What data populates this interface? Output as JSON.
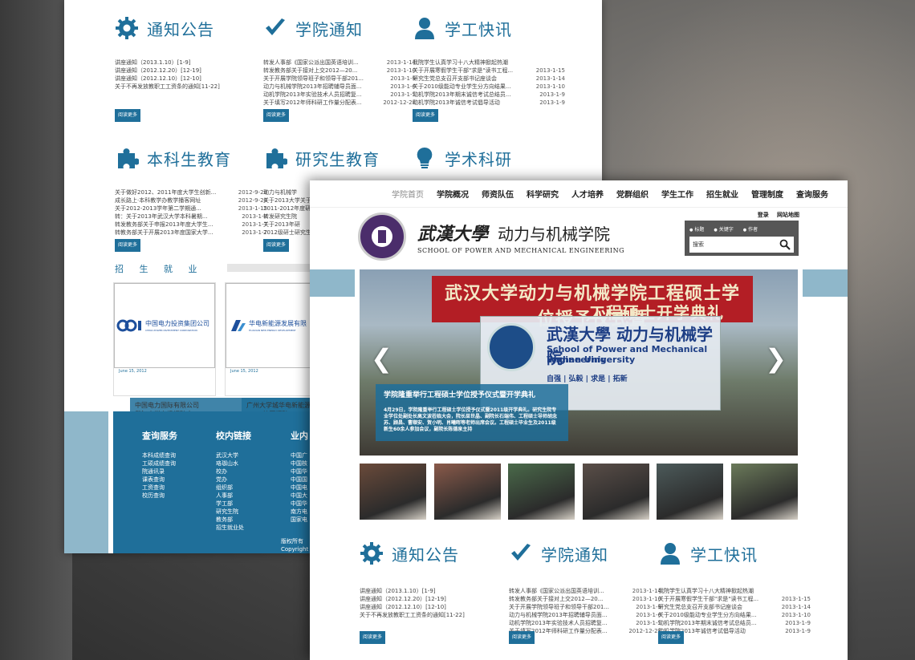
{
  "back": {
    "sections": [
      {
        "key": "notice",
        "title": "通知公告",
        "icon": "gear-icon",
        "items": [
          {
            "t": "讲座通知（2013.1.10）[1-9]",
            "d": ""
          },
          {
            "t": "讲座通知（2012.12.20）[12-19]",
            "d": ""
          },
          {
            "t": "讲座通知（2012.12.10）[12-10]",
            "d": ""
          },
          {
            "t": "关于不再发放教职工工资条的通知[11-22]",
            "d": ""
          }
        ]
      },
      {
        "key": "college",
        "title": "学院通知",
        "icon": "checkmark-icon",
        "items": [
          {
            "t": "转发人事部《国家公派出国英语培训...",
            "d": "2013-1-14"
          },
          {
            "t": "转发教务部关于接对上交2012—20...",
            "d": "2013-1-10"
          },
          {
            "t": "关于开展学院领导班子和领导干部201...",
            "d": "2013-1-9"
          },
          {
            "t": "动力与机械学院2013年招聘辅导员面...",
            "d": "2013-1-6"
          },
          {
            "t": "动机学院2013年实验技术人员招聘复...",
            "d": "2013-1-5"
          },
          {
            "t": "关于填写2012年师科研工作量分配表...",
            "d": "2012-12-28"
          }
        ]
      },
      {
        "key": "student",
        "title": "学工快讯",
        "icon": "user-icon",
        "items": [
          {
            "t": "我院学生认真学习十八大精神掀起热潮",
            "d": ""
          },
          {
            "t": "关于开展寒假学生干部\"求是\"读书工程...",
            "d": "2013-1-15"
          },
          {
            "t": "研究生党总支召开支部书记座谈会",
            "d": "2013-1-14"
          },
          {
            "t": "关于2010级能动专业学生分方向结果...",
            "d": "2013-1-10"
          },
          {
            "t": "动机学院2013年期末诚信考试总结员...",
            "d": "2013-1-9"
          },
          {
            "t": "动机学院2013年诚信考试倡导活动",
            "d": "2013-1-9"
          }
        ]
      },
      {
        "key": "undergrad",
        "title": "本科生教育",
        "icon": "puzzle-icon",
        "items": [
          {
            "t": "关于做好2012、2011年度大学生创新...",
            "d": "2012-9-28"
          },
          {
            "t": "成长路上·本科教学办教学播客网址",
            "d": "2012-9-28"
          },
          {
            "t": "关于2012-2013学年第二学期通...",
            "d": "2013-1-15"
          },
          {
            "t": "转：关于2013年武汉大学本科暑期...",
            "d": "2013-1-8"
          },
          {
            "t": "转发教务部关于申报2013年度大学生...",
            "d": "2013-1-7"
          },
          {
            "t": "转教务部关于开展2013年度国家大学...",
            "d": "2013-1-7"
          }
        ]
      },
      {
        "key": "graduate",
        "title": "研究生教育",
        "icon": "puzzle-icon",
        "items": [
          {
            "t": "动力与机械学",
            "d": ""
          },
          {
            "t": "关于2013大学关于调整",
            "d": ""
          },
          {
            "t": "2011-2012年度研究",
            "d": ""
          },
          {
            "t": "转发研究生院",
            "d": ""
          },
          {
            "t": "关于2013年研",
            "d": ""
          },
          {
            "t": "2012级研士研究生",
            "d": ""
          }
        ]
      },
      {
        "key": "research",
        "title": "学术科研",
        "icon": "lightbulb-icon",
        "items": []
      }
    ],
    "more_label": "阅读更多",
    "jobs_title": "招 生 就 业",
    "cards": [
      {
        "company": "中国电力投资集团公司",
        "company_en": "CHINA POWER INVESTMENT CORPORATION",
        "caption": "中国电力国际有限公司\n武汉大学专场招聘会",
        "date": "June 15, 2012"
      },
      {
        "company": "华电新能源发展有限",
        "company_en": "HUADIAN NEW ENERGY DEVELOPMENT",
        "caption": "广州大学城华电新能源有限\n2013校园招聘",
        "date": "June 15, 2012"
      }
    ],
    "footer": {
      "cols": [
        {
          "h": "查询服务",
          "items": [
            "本科成绩查询",
            "工硕成绩查询",
            "院通讯录",
            "课表查询",
            "工资查询",
            "校历查询"
          ]
        },
        {
          "h": "校内链接",
          "items": [
            "武汉大学",
            "珞珈山水",
            "校办",
            "党办",
            "组织部",
            "人事部",
            "学工部",
            "研究生院",
            "教务部",
            "招生就业处"
          ]
        },
        {
          "h": "业内",
          "items": [
            "中国广",
            "中国核",
            "中国华",
            "中国国",
            "中国电",
            "中国大",
            "中国华",
            "南方电",
            "国家电"
          ]
        }
      ],
      "copyright": "版权所有\nCopyright"
    }
  },
  "front": {
    "nav": [
      "学院首页",
      "学院概况",
      "师资队伍",
      "科学研究",
      "人才培养",
      "党群组织",
      "学生工作",
      "招生就业",
      "管理制度",
      "查询服务"
    ],
    "active_nav": "学院首页",
    "toplinks": [
      "登录",
      "网站地图"
    ],
    "brand": {
      "cn1": "武漢大學",
      "cn2": "动力与机械学院",
      "en": "SCHOOL OF POWER AND MECHANICAL ENGINEERING"
    },
    "search": {
      "options": [
        "标题",
        "关键字",
        "作者"
      ],
      "placeholder": "搜索"
    },
    "slide": {
      "banner1": "武汉大学动力与机械学院工程硕士学位授予仪式暨",
      "banner2": "工程硕士开学典礼",
      "board_cn": "武漢大學 动力与机械学院",
      "board_en1": "School of Power and Mechanical Engineering",
      "board_en2": "Wuhan University",
      "motto": "自强 | 弘毅 | 求是 | 拓新",
      "caption_title": "学院隆重举行工程硕士学位授予仪式暨开学典礼",
      "caption_desc": "4月29日，学院隆重举行工程硕士学位授予仪式暨2011级开学典礼。研究生院专业学位处副处长高文波莅临大会，院长巫世晶、副院长石端伟、工程硕士导师胡念苏、顾昌、曹顺安、贺小明、肖曦晖等老师出席会议。工程硕士毕业生及2011级新生60余人参加会议，副院长陈德泉主持"
    },
    "thumb_colors": [
      "#6a4a3a",
      "#8a5a4a",
      "#4a6a4a",
      "#5a4e48",
      "#4c5a5a",
      "#6b7a5a"
    ],
    "sections": [
      {
        "title": "通知公告",
        "icon": "gear-icon",
        "items": [
          {
            "t": "讲座通知（2013.1.10）[1-9]",
            "d": ""
          },
          {
            "t": "讲座通知（2012.12.20）[12-19]",
            "d": ""
          },
          {
            "t": "讲座通知（2012.12.10）[12-10]",
            "d": ""
          },
          {
            "t": "关于不再发放教职工工资条的通知[11-22]",
            "d": ""
          }
        ]
      },
      {
        "title": "学院通知",
        "icon": "checkmark-icon",
        "items": [
          {
            "t": "转发人事部《国家公派出国英语培训...",
            "d": "2013-1-14"
          },
          {
            "t": "转发教务部关于接对上交2012—20...",
            "d": "2013-1-10"
          },
          {
            "t": "关于开展学院领导班子和领导干部201...",
            "d": "2013-1-9"
          },
          {
            "t": "动力与机械学院2013年招聘辅导员面...",
            "d": "2013-1-6"
          },
          {
            "t": "动机学院2013年实验技术人员招聘复...",
            "d": "2013-1-5"
          },
          {
            "t": "关于填写2012年师科研工作量分配表...",
            "d": "2012-12-28"
          }
        ]
      },
      {
        "title": "学工快讯",
        "icon": "user-icon",
        "items": [
          {
            "t": "我院学生认真学习十八大精神掀起热潮",
            "d": ""
          },
          {
            "t": "关于开展寒假学生干部\"求是\"读书工程...",
            "d": "2013-1-15"
          },
          {
            "t": "研究生党总支召开支部书记座谈会",
            "d": "2013-1-14"
          },
          {
            "t": "关于2010级能动专业学生分方向结果...",
            "d": "2013-1-10"
          },
          {
            "t": "动机学院2013年期末诚信考试总结员...",
            "d": "2013-1-9"
          },
          {
            "t": "动机学院2013年诚信考试倡导活动",
            "d": "2013-1-9"
          }
        ]
      }
    ],
    "more_label": "阅读更多"
  },
  "colors": {
    "accent": "#1f6f9a",
    "light_accent": "#8fb7ca",
    "banner_red": "#b31e25"
  }
}
